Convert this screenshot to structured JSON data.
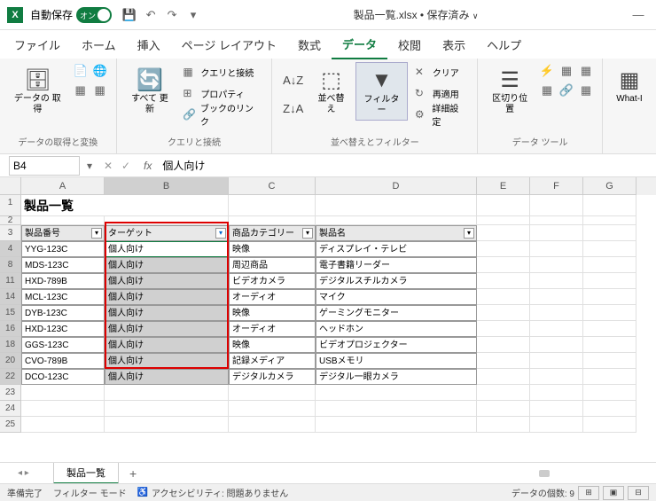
{
  "titlebar": {
    "autosave": "自動保存",
    "toggle_on": "オン",
    "filename": "製品一覧.xlsx",
    "saved_state": "保存済み"
  },
  "menu": {
    "file": "ファイル",
    "home": "ホーム",
    "insert": "挿入",
    "page_layout": "ページ レイアウト",
    "formulas": "数式",
    "data": "データ",
    "review": "校閲",
    "view": "表示",
    "help": "ヘルプ"
  },
  "ribbon": {
    "group1": {
      "get_data": "データの\n取得",
      "label": "データの取得と変換"
    },
    "group2": {
      "refresh_all": "すべて\n更新",
      "queries": "クエリと接続",
      "properties": "プロパティ",
      "edit_links": "ブックのリンク",
      "label": "クエリと接続"
    },
    "group3": {
      "sort": "並べ替え",
      "filter": "フィルター",
      "clear": "クリア",
      "reapply": "再適用",
      "advanced": "詳細設定",
      "label": "並べ替えとフィルター"
    },
    "group4": {
      "text_to_columns": "区切り位置",
      "label": "データ ツール"
    },
    "group5": {
      "what_if": "What-I"
    }
  },
  "formula_bar": {
    "name_box": "B4",
    "formula_value": "個人向け"
  },
  "columns": [
    "A",
    "B",
    "C",
    "D",
    "E",
    "F",
    "G"
  ],
  "sheet": {
    "title": "製品一覧",
    "headers": {
      "product_no": "製品番号",
      "target": "ターゲット",
      "category": "商品カテゴリー",
      "product_name": "製品名"
    },
    "row_numbers": [
      "1",
      "2",
      "3",
      "4",
      "8",
      "11",
      "14",
      "15",
      "16",
      "18",
      "20",
      "22",
      "23",
      "24",
      "25"
    ],
    "rows": [
      {
        "no": "YYG-123C",
        "target": "個人向け",
        "cat": "映像",
        "name": "ディスプレイ・テレビ"
      },
      {
        "no": "MDS-123C",
        "target": "個人向け",
        "cat": "周辺商品",
        "name": "電子書籍リーダー"
      },
      {
        "no": "HXD-789B",
        "target": "個人向け",
        "cat": "ビデオカメラ",
        "name": "デジタルスチルカメラ"
      },
      {
        "no": "MCL-123C",
        "target": "個人向け",
        "cat": "オーディオ",
        "name": "マイク"
      },
      {
        "no": "DYB-123C",
        "target": "個人向け",
        "cat": "映像",
        "name": "ゲーミングモニター"
      },
      {
        "no": "HXD-123C",
        "target": "個人向け",
        "cat": "オーディオ",
        "name": "ヘッドホン"
      },
      {
        "no": "GGS-123C",
        "target": "個人向け",
        "cat": "映像",
        "name": "ビデオプロジェクター"
      },
      {
        "no": "CVO-789B",
        "target": "個人向け",
        "cat": "記録メディア",
        "name": "USBメモリ"
      },
      {
        "no": "DCO-123C",
        "target": "個人向け",
        "cat": "デジタルカメラ",
        "name": "デジタル一眼カメラ"
      }
    ]
  },
  "tabs": {
    "sheet_name": "製品一覧"
  },
  "statusbar": {
    "ready": "準備完了",
    "filter_mode": "フィルター モード",
    "accessibility": "アクセシビリティ: 問題ありません",
    "count": "データの個数: 9"
  }
}
